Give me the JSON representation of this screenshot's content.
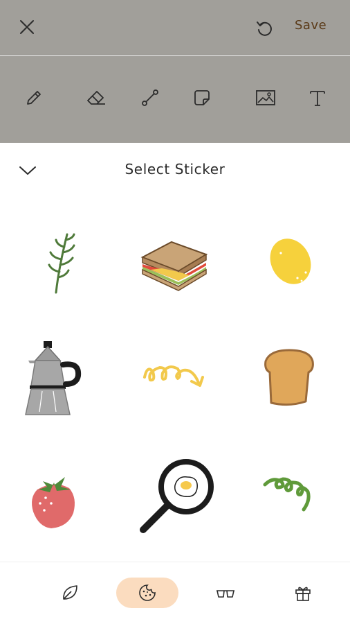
{
  "header": {
    "close_icon": "close-icon",
    "undo_icon": "undo-icon",
    "save_label": "Save"
  },
  "toolbar": {
    "tools": [
      "pencil-icon",
      "eraser-icon",
      "line-icon",
      "sticker-icon",
      "image-icon",
      "text-icon"
    ]
  },
  "sheet": {
    "title": "Select Sticker",
    "collapse_icon": "chevron-down-icon"
  },
  "stickers": [
    "rosemary-sprig",
    "sandwich",
    "lemon",
    "moka-pot",
    "yellow-squiggle-arrow",
    "toast",
    "strawberry",
    "frying-pan-egg",
    "green-spiral"
  ],
  "categories": {
    "items": [
      "leaf-icon",
      "cookie-icon",
      "glasses-icon",
      "gift-icon"
    ],
    "selected": "cookie-icon"
  },
  "colors": {
    "dim_overlay": "#a19f9a",
    "save_text": "#5a3a18",
    "active_category": "#fbdcbf"
  }
}
